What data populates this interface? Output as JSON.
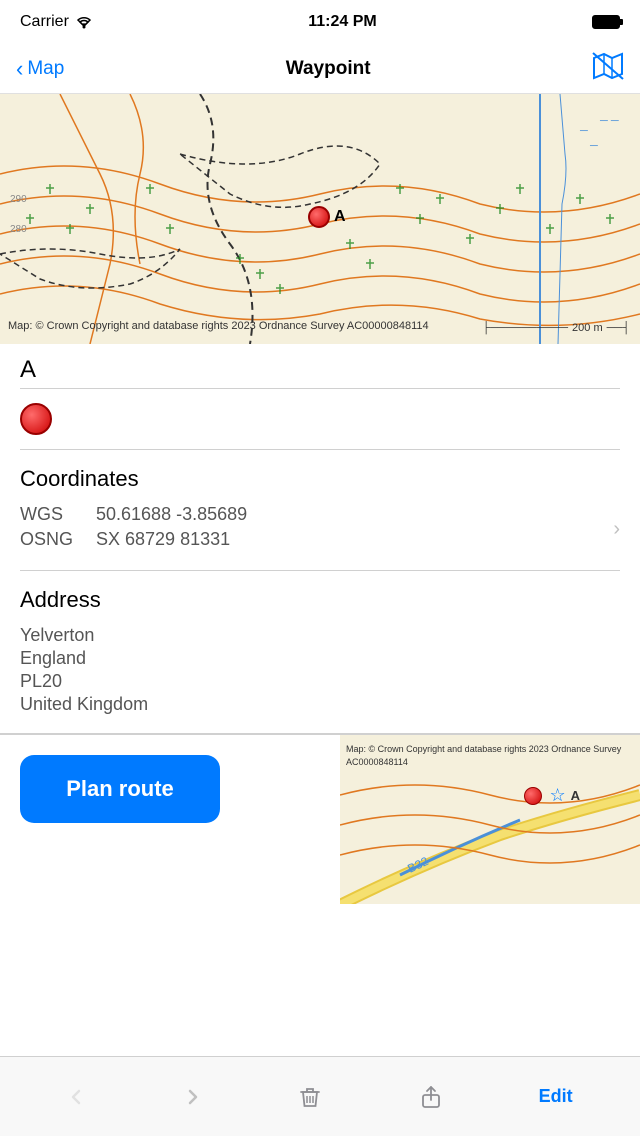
{
  "status_bar": {
    "carrier": "Carrier",
    "time": "11:24 PM"
  },
  "nav": {
    "back_label": "Map",
    "title": "Waypoint"
  },
  "map": {
    "copyright": "Map: © Crown Copyright and\ndatabase rights 2023 Ordnance\nSurvey AC00000848114",
    "scale_label": "200 m",
    "waypoint_label": "A"
  },
  "waypoint_name": "A",
  "coordinates": {
    "heading": "Coordinates",
    "wgs_label": "WGS",
    "wgs_value": "50.61688  -3.85689",
    "osng_label": "OSNG",
    "osng_value": "SX 68729 81331"
  },
  "address": {
    "heading": "Address",
    "line1": "Yelverton",
    "line2": "England",
    "line3": "PL20",
    "line4": "United Kingdom"
  },
  "bottom": {
    "plan_route_label": "Plan route",
    "thumb_copyright": "Map: © Crown\nCopyright and\ndatabase rights\n2023 Ordnance\nSurvey\nAC0000848114"
  },
  "toolbar": {
    "back_label": "<",
    "forward_label": ">",
    "delete_label": "🗑",
    "share_label": "⬆",
    "edit_label": "Edit"
  }
}
